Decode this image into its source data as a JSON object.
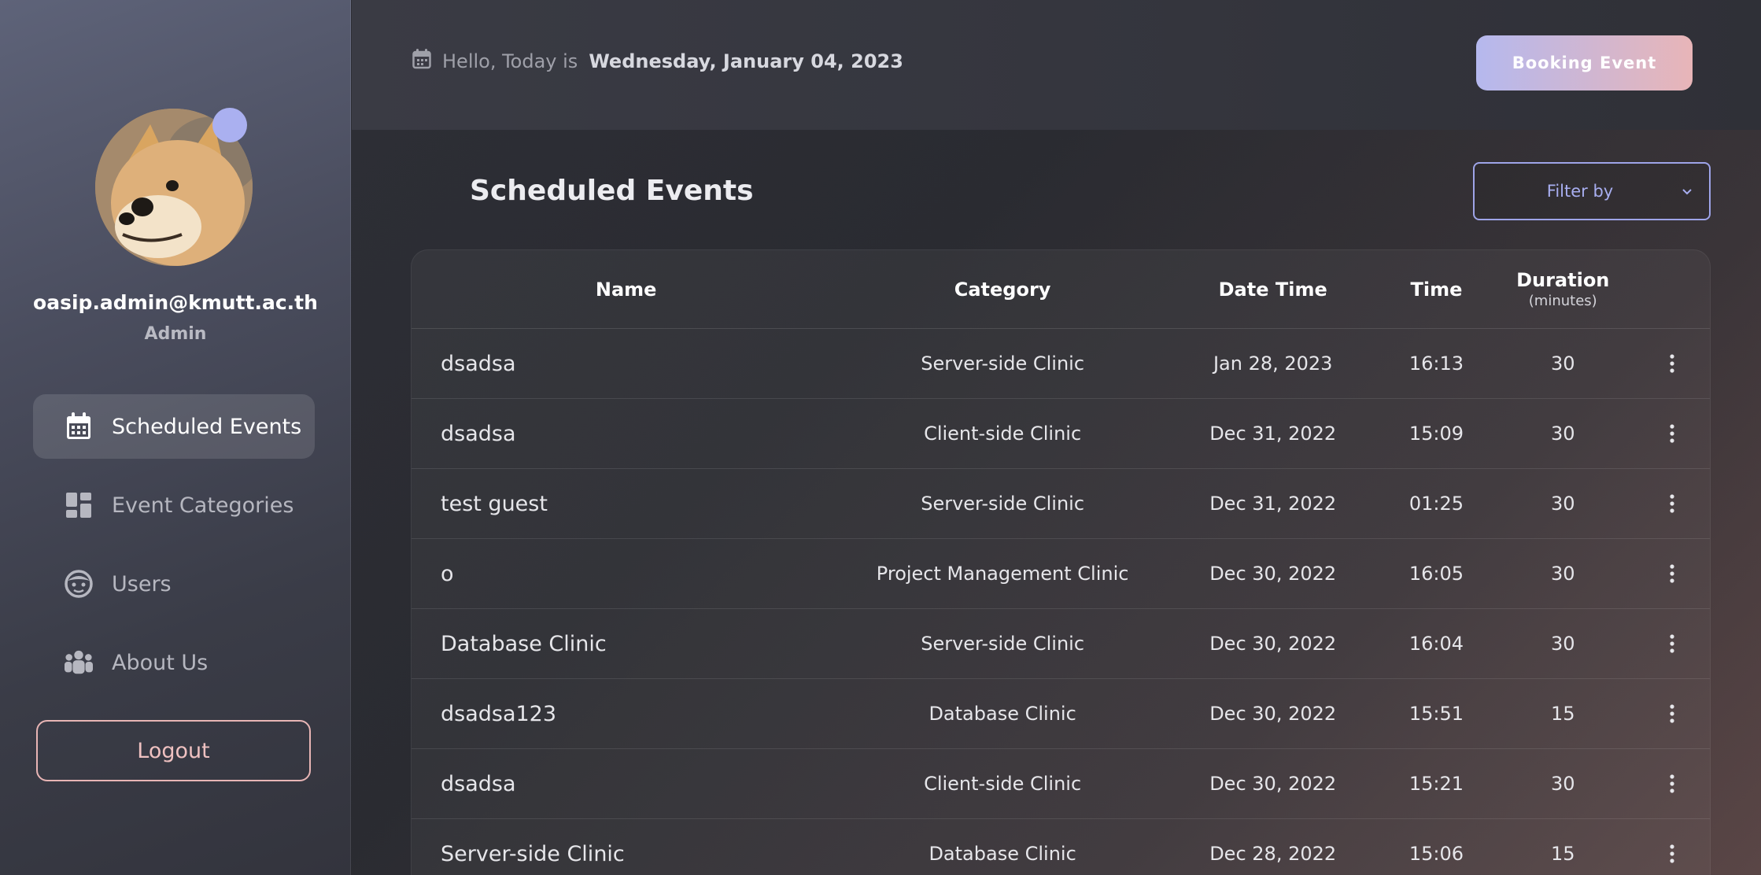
{
  "sidebar": {
    "user_email": "oasip.admin@kmutt.ac.th",
    "user_role": "Admin",
    "nav": [
      {
        "label": "Scheduled Events",
        "icon": "calendar-icon",
        "active": true
      },
      {
        "label": "Event Categories",
        "icon": "grid-icon",
        "active": false
      },
      {
        "label": "Users",
        "icon": "user-face-icon",
        "active": false
      },
      {
        "label": "About Us",
        "icon": "team-icon",
        "active": false
      }
    ],
    "logout_label": "Logout"
  },
  "header": {
    "greeting": "Hello, Today is",
    "date": "Wednesday, January 04, 2023",
    "booking_label": "Booking Event"
  },
  "main": {
    "title": "Scheduled Events",
    "filter_label": "Filter by",
    "columns": {
      "name": "Name",
      "category": "Category",
      "datetime": "Date Time",
      "time": "Time",
      "duration": "Duration",
      "duration_unit": "(minutes)"
    },
    "rows": [
      {
        "name": "dsadsa",
        "category": "Server-side Clinic",
        "date": "Jan 28, 2023",
        "time": "16:13",
        "duration": "30"
      },
      {
        "name": "dsadsa",
        "category": "Client-side Clinic",
        "date": "Dec 31, 2022",
        "time": "15:09",
        "duration": "30"
      },
      {
        "name": "test guest",
        "category": "Server-side Clinic",
        "date": "Dec 31, 2022",
        "time": "01:25",
        "duration": "30"
      },
      {
        "name": "o",
        "category": "Project Management Clinic",
        "date": "Dec 30, 2022",
        "time": "16:05",
        "duration": "30"
      },
      {
        "name": "Database Clinic",
        "category": "Server-side Clinic",
        "date": "Dec 30, 2022",
        "time": "16:04",
        "duration": "30"
      },
      {
        "name": "dsadsa123",
        "category": "Database Clinic",
        "date": "Dec 30, 2022",
        "time": "15:51",
        "duration": "15"
      },
      {
        "name": "dsadsa",
        "category": "Client-side Clinic",
        "date": "Dec 30, 2022",
        "time": "15:21",
        "duration": "30"
      },
      {
        "name": "Server-side Clinic",
        "category": "Database Clinic",
        "date": "Dec 28, 2022",
        "time": "15:06",
        "duration": "15"
      }
    ]
  },
  "colors": {
    "accent": "#aab0f0",
    "logout_border": "#e8b5b5",
    "booking_gradient_start": "#b5b8ee",
    "booking_gradient_end": "#e8b5b8"
  }
}
